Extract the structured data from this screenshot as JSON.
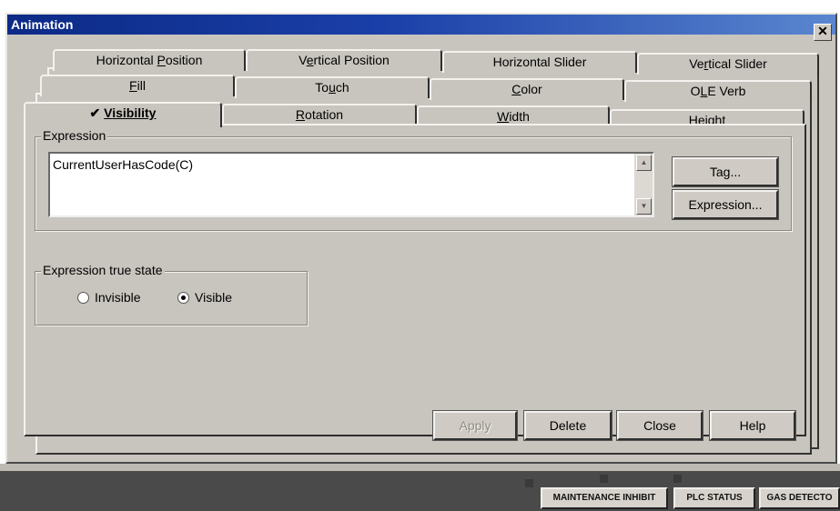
{
  "dialog": {
    "title": "Animation",
    "close_glyph": "✕"
  },
  "tabs": {
    "row1": [
      {
        "pre": "Horizontal ",
        "ul": "P",
        "post": "osition"
      },
      {
        "pre": "V",
        "ul": "e",
        "post": "rtical Position"
      },
      {
        "pre": "Horizontal Slider",
        "ul": "",
        "post": ""
      },
      {
        "pre": "Ve",
        "ul": "r",
        "post": "tical Slider"
      }
    ],
    "row2": [
      {
        "pre": "",
        "ul": "F",
        "post": "ill"
      },
      {
        "pre": "To",
        "ul": "u",
        "post": "ch"
      },
      {
        "pre": "",
        "ul": "C",
        "post": "olor"
      },
      {
        "pre": "O",
        "ul": "L",
        "post": "E Verb"
      }
    ],
    "row3": [
      {
        "pre": "✔ ",
        "ul": "V",
        "post": "isibility"
      },
      {
        "pre": "",
        "ul": "R",
        "post": "otation"
      },
      {
        "pre": "",
        "ul": "W",
        "post": "idth"
      },
      {
        "pre": "Height",
        "ul": "",
        "post": ""
      }
    ]
  },
  "expression_group": {
    "label": "Expression",
    "value": "CurrentUserHasCode(C)"
  },
  "side_buttons": {
    "tag": "Tag...",
    "expression": "Expression..."
  },
  "true_state_group": {
    "label": "Expression true state",
    "options": [
      {
        "label": "Invisible",
        "selected": false
      },
      {
        "label": "Visible",
        "selected": true
      }
    ]
  },
  "footer_buttons": {
    "apply": "Apply",
    "delete": "Delete",
    "close": "Close",
    "help": "Help"
  },
  "status_bar": {
    "maintenance": "MAINTENANCE INHIBIT",
    "plc": "PLC STATUS",
    "gas": "GAS DETECTO"
  }
}
